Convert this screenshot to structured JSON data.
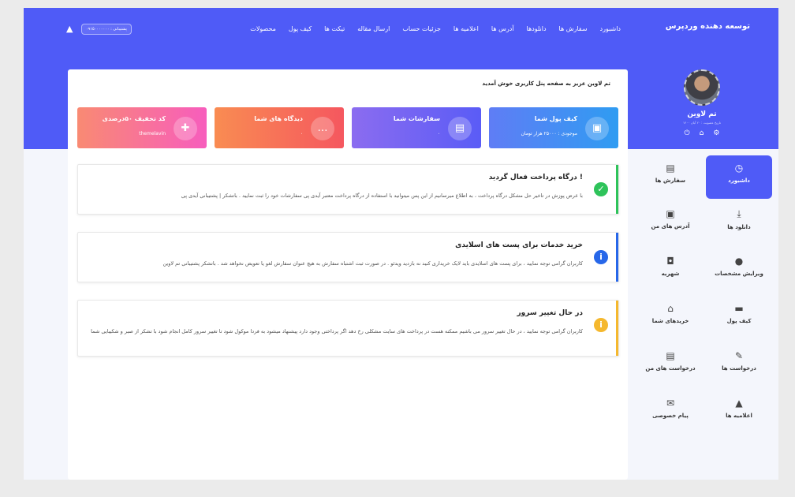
{
  "header": {
    "brand": "توسعه دهنده وردپرس",
    "nav": [
      "داشبورد",
      "سفارش ها",
      "دانلودها",
      "آدرس ها",
      "اعلامیه ها",
      "جزئیات حساب",
      "ارسال مقاله",
      "تیکت ها",
      "کیف پول",
      "محصولات"
    ],
    "support": "پشتیبانی : ۰۹۱۵۰۰۰۰۰۰۰"
  },
  "profile": {
    "name": "تم لاوین",
    "date": "تاریخ عضویت : ۲۰ آبان ۱۴۰۰"
  },
  "sidebar": {
    "items": [
      {
        "label": "داشبورد",
        "icon": "dashboard-icon",
        "glyph": "◷",
        "active": true
      },
      {
        "label": "سفارش ها",
        "icon": "document-icon",
        "glyph": "▤",
        "active": false
      },
      {
        "label": "دانلود ها",
        "icon": "download-icon",
        "glyph": "⤓",
        "active": false
      },
      {
        "label": "آدرس های من",
        "icon": "contact-card-icon",
        "glyph": "▣",
        "active": false
      },
      {
        "label": "ویرایش مشخصات",
        "icon": "user-icon",
        "glyph": "●",
        "active": false
      },
      {
        "label": "شهریه",
        "icon": "bag-icon",
        "glyph": "◘",
        "active": false
      },
      {
        "label": "کیف پول",
        "icon": "wallet-icon",
        "glyph": "▬",
        "active": false
      },
      {
        "label": "خریدهای شما",
        "icon": "basket-icon",
        "glyph": "⌂",
        "active": false
      },
      {
        "label": "درخواست ها",
        "icon": "pencil-icon",
        "glyph": "✎",
        "active": false
      },
      {
        "label": "درخواست های من",
        "icon": "file-icon",
        "glyph": "▤",
        "active": false
      },
      {
        "label": "اعلامیه ها",
        "icon": "bell-icon",
        "glyph": "▲",
        "active": false
      },
      {
        "label": "پیام خصوصی",
        "icon": "envelope-icon",
        "glyph": "✉",
        "active": false
      }
    ]
  },
  "welcome": "تم لاوین عزیز به صفحه پنل کاربری خوش آمدید",
  "cards": [
    {
      "title": "کیف پول شما",
      "value": "موجودی : ۲۵۰۰۰ هزار تومان",
      "icon": "wallet-icon",
      "glyph": "▣",
      "colors": [
        "#2f9cf2",
        "#5f7df5"
      ]
    },
    {
      "title": "سفارشات شما",
      "value": "۰",
      "icon": "invoice-icon",
      "glyph": "▤",
      "colors": [
        "#5a5cf6",
        "#8b6cf0"
      ]
    },
    {
      "title": "دیدگاه های شما",
      "value": "۰",
      "icon": "chat-icon",
      "glyph": "…",
      "colors": [
        "#f5575f",
        "#f98c52"
      ]
    },
    {
      "title": "کد تخفیف ۵۰درصدی",
      "value": "themelavin",
      "icon": "gift-icon",
      "glyph": "✚",
      "colors": [
        "#f75dbd",
        "#f98a73"
      ]
    }
  ],
  "notices": [
    {
      "title": "درگاه پرداخت فعال گردید !",
      "body": "با عرض پوزش در تاخیر حل مشکل درگاه پرداخت ، به اطلاع میرسانیم از این پس میتوانید با استفاده از درگاه پرداخت معتبر آیدی پی سفارشات خود را ثبت نمایید . باتشکر | پشتیبانی آیدی پی",
      "color": "#2ec35a",
      "glyph": "✓",
      "icon": "check-circle-icon"
    },
    {
      "title": "خرید خدمات برای پست های اسلایدی",
      "body": "کاربران گرامی توجه نمایید ، برای پست های اسلایدی باید لایک خریداری کنید نه بازدید ویدئو . در صورت ثبت اشتباه سفارش به هیچ عنوان سفارش لغو یا تعویض نخواهد شد . باتشکر پشتیبانی تم لاوین",
      "color": "#2767e9",
      "glyph": "i",
      "icon": "info-circle-icon"
    },
    {
      "title": "در حال تغییر سرور",
      "body": "کاربران گرامی توجه نمایید ، در حال تغییر سرور می باشیم ممکنه هست در پرداخت های سایت مشکلی رخ دهد اگر پرداختی وجود دارد پیشنهاد میشود به فردا موکول شود تا تغییر سرور کامل انجام شود با تشکر از صبر و شکیبایی شما",
      "color": "#f5b82e",
      "glyph": "i",
      "icon": "warning-circle-icon"
    }
  ]
}
